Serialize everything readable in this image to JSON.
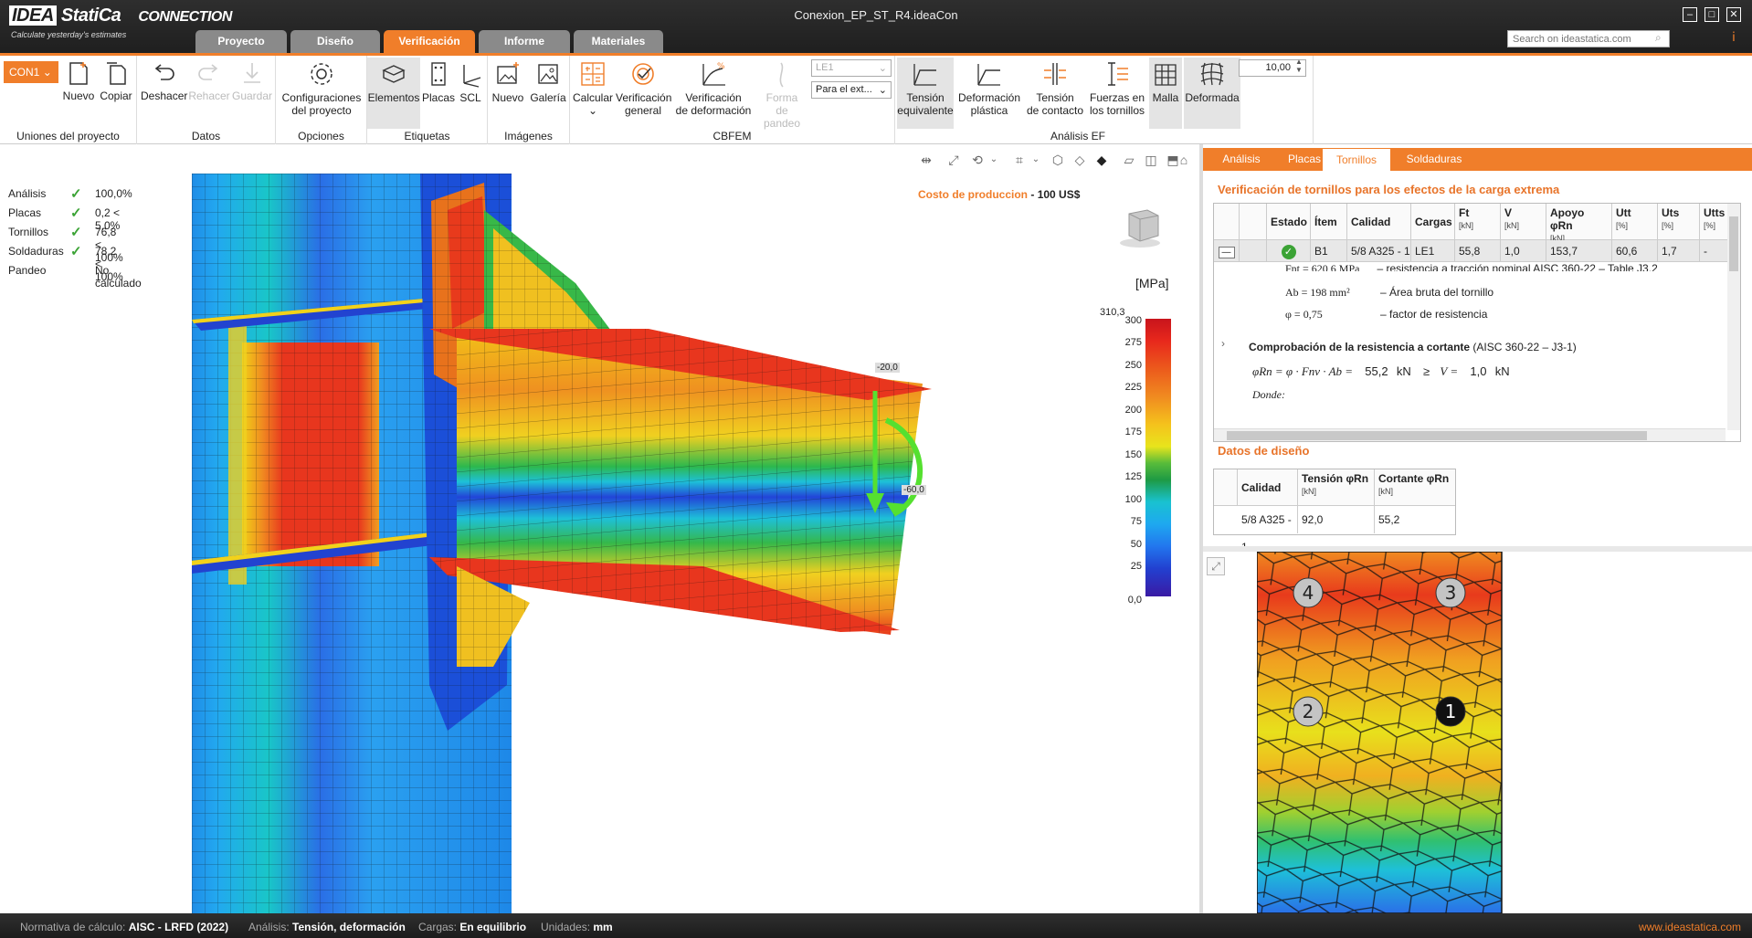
{
  "app": {
    "logo_brand": "IDEA",
    "logo_name": "StatiCa",
    "logo_product": "CONNECTION",
    "tagline": "Calculate yesterday's estimates",
    "document_title": "Conexion_EP_ST_R4.ideaCon",
    "search_placeholder": "Search on ideastatica.com"
  },
  "main_tabs": [
    {
      "label": "Proyecto",
      "active": false
    },
    {
      "label": "Diseño",
      "active": false
    },
    {
      "label": "Verificación",
      "active": true
    },
    {
      "label": "Informe",
      "active": false
    },
    {
      "label": "Materiales",
      "active": false
    }
  ],
  "ribbon": {
    "connection": "CON1",
    "groups": {
      "unions": "Uniones del proyecto",
      "data": "Datos",
      "options": "Opciones",
      "labels": "Etiquetas",
      "images": "Imágenes",
      "cbfem": "CBFEM",
      "fea": "Análisis EF"
    },
    "buttons": {
      "new": "Nuevo",
      "copy": "Copiar",
      "undo": "Deshacer",
      "redo": "Rehacer",
      "save": "Guardar",
      "config_1": "Configuraciones",
      "config_2": "del proyecto",
      "elements": "Elementos",
      "plates": "Placas",
      "scl": "SCL",
      "new_image": "Nuevo",
      "gallery": "Galería",
      "calculate": "Calcular",
      "general_1": "Verificación",
      "general_2": "general",
      "deform_1": "Verificación",
      "deform_2": "de deformación",
      "buckling_1": "Forma",
      "buckling_2": "de pandeo",
      "equiv_1": "Tensión",
      "equiv_2": "equivalente",
      "plastic_1": "Deformación",
      "plastic_2": "plástica",
      "contact_1": "Tensión",
      "contact_2": "de contacto",
      "boltforces_1": "Fuerzas en",
      "boltforces_2": "los tornillos",
      "mesh": "Malla",
      "deformed": "Deformada"
    },
    "load_case": "LE1",
    "load_extent": "Para el ext...",
    "scale_value": "10,00"
  },
  "status": [
    {
      "key": "Análisis",
      "check": true,
      "value": "100,0%"
    },
    {
      "key": "Placas",
      "check": true,
      "value": "0,2 < 5,0%"
    },
    {
      "key": "Tornillos",
      "check": true,
      "value": "76,8 < 100%"
    },
    {
      "key": "Soldaduras",
      "check": true,
      "value": "78,2 < 100%"
    },
    {
      "key": "Pandeo",
      "check": false,
      "value": "No calculado"
    }
  ],
  "viewport": {
    "cost_label": "Costo de produccion",
    "cost_sep": "-",
    "cost_value": "100 US$",
    "load_label_1": "-20,0",
    "load_label_2": "-60,0"
  },
  "legend": {
    "unit": "[MPa]",
    "max": "310,3",
    "ticks": [
      "300",
      "275",
      "250",
      "225",
      "200",
      "175",
      "150",
      "125",
      "100",
      "75",
      "50",
      "25",
      "0,0"
    ]
  },
  "right_panel": {
    "tabs": [
      {
        "label": "Análisis",
        "active": false
      },
      {
        "label": "Placas",
        "active": false
      },
      {
        "label": "Tornillos",
        "active": true
      },
      {
        "label": "Soldaduras",
        "active": false
      }
    ],
    "title": "Verificación de tornillos para los efectos de la carga extrema",
    "bolt_headers": [
      {
        "label": "",
        "unit": ""
      },
      {
        "label": "",
        "unit": ""
      },
      {
        "label": "Estado",
        "unit": ""
      },
      {
        "label": "Ítem",
        "unit": ""
      },
      {
        "label": "Calidad",
        "unit": ""
      },
      {
        "label": "Cargas",
        "unit": ""
      },
      {
        "label": "Ft",
        "unit": "[kN]"
      },
      {
        "label": "V",
        "unit": "[kN]"
      },
      {
        "label": "Apoyo φRn",
        "unit": "[kN]"
      },
      {
        "label": "Utt",
        "unit": "[%]"
      },
      {
        "label": "Uts",
        "unit": "[%]"
      },
      {
        "label": "Utts",
        "unit": "[%]"
      }
    ],
    "bolt_row": {
      "toggle": "—",
      "item": "B1",
      "quality": "5/8 A325 - 1",
      "loads": "LE1",
      "ft": "55,8",
      "v": "1,0",
      "bearing": "153,7",
      "utt": "60,6",
      "uts": "1,7",
      "utts": "-"
    },
    "detail": {
      "line0_sym": "Fnt = 620,6 MPa",
      "line0_desc": "– resistencia a tracción nominal AISC 360-22 – Table J3.2",
      "line1_sym": "Ab = 198 mm²",
      "line1_desc": "– Área bruta del tornillo",
      "line2_sym": "φ = 0,75",
      "line2_desc": "– factor de resistencia",
      "shear_title": "Comprobación de la resistencia a cortante",
      "shear_ref": "(AISC 360-22 – J3-1)",
      "shear_formula": "φRn = φ · Fnv · Ab =",
      "shear_val1": "55,2",
      "shear_unit1": "kN",
      "shear_ge": "≥",
      "shear_v": "V =",
      "shear_val2": "1,0",
      "shear_unit2": "kN",
      "where": "Donde:"
    },
    "design_title": "Datos de diseño",
    "design_headers": [
      {
        "label": "Calidad",
        "unit": ""
      },
      {
        "label": "Tensión φRn",
        "unit": "[kN]"
      },
      {
        "label": "Cortante φRn",
        "unit": "[kN]"
      }
    ],
    "design_row": {
      "quality": "5/8 A325 - 1",
      "tension": "92,0",
      "shear": "55,2"
    },
    "bolt_numbers": [
      "1",
      "2",
      "3",
      "4"
    ]
  },
  "statusbar": {
    "code_label": "Normativa de cálculo:",
    "code_value": "AISC - LRFD (2022)",
    "analysis_label": "Análisis:",
    "analysis_value": "Tensión, deformación",
    "loads_label": "Cargas:",
    "loads_value": "En equilibrio",
    "units_label": "Unidades:",
    "units_value": "mm",
    "site": "www.ideastatica.com"
  },
  "colors": {
    "accent": "#f07e2a",
    "check_green": "#3ba335",
    "header_dark": "#1f1f1f"
  }
}
